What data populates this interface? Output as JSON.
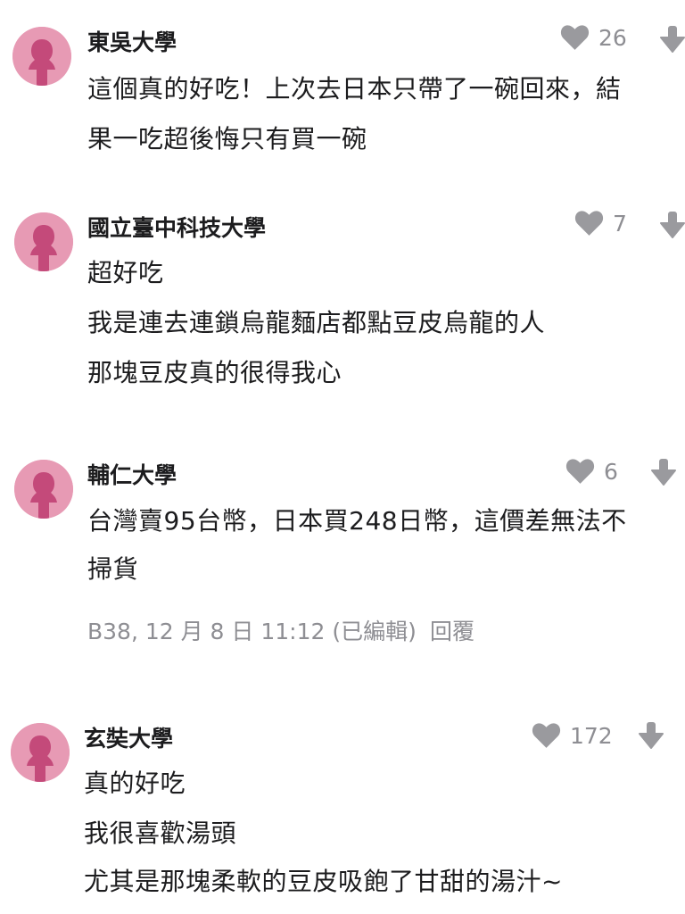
{
  "colors": {
    "avatar_bg": "#e79ab4",
    "avatar_figure": "#c44a7a",
    "icon_gray": "#9a9a9e",
    "text_primary": "#1c1c1e",
    "text_secondary": "#8e8e93"
  },
  "icons": {
    "like": "heart-icon",
    "dislike": "down-arrow-icon",
    "avatar": "female-avatar-icon"
  },
  "comments": [
    {
      "author": "東吳大學",
      "likes": "26",
      "lines": [
        "這個真的好吃！上次去日本只帶了一碗回來，結",
        "果一吃超後悔只有買一碗"
      ]
    },
    {
      "author": "國立臺中科技大學",
      "likes": "7",
      "lines": [
        "超好吃",
        "我是連去連鎖烏龍麵店都點豆皮烏龍的人",
        "那塊豆皮真的很得我心"
      ]
    },
    {
      "author": "輔仁大學",
      "likes": "6",
      "lines": [
        "台灣賣95台幣，日本買248日幣，這價差無法不",
        "掃貨"
      ],
      "meta": "B38, 12 月 8 日 11:12 (已編輯)",
      "reply": "回覆"
    },
    {
      "author": "玄奘大學",
      "likes": "172",
      "lines": [
        "真的好吃",
        "我很喜歡湯頭",
        "尤其是那塊柔軟的豆皮吸飽了甘甜的湯汁~"
      ]
    }
  ]
}
